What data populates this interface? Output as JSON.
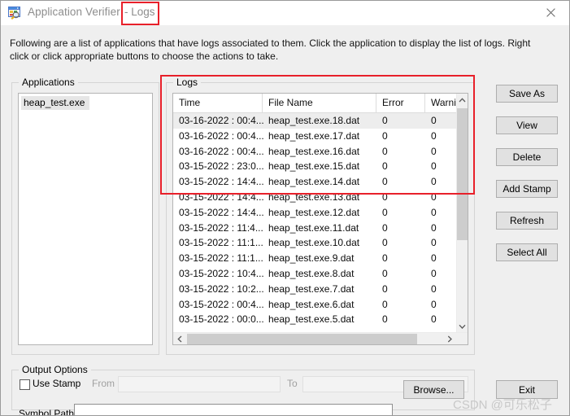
{
  "window": {
    "title": "Application Verifier",
    "subtitle": "- Logs",
    "icon": "app-verifier-icon",
    "close_label": "✕",
    "accent_annotation_color": "#e8202a"
  },
  "description": "Following are a list of applications that have logs associated to them. Click the application to display the list of logs. Right click or click appropriate buttons to choose the actions to take.",
  "applications": {
    "group_label": "Applications",
    "items": [
      {
        "label": "heap_test.exe",
        "selected": true
      }
    ]
  },
  "logs": {
    "group_label": "Logs",
    "columns": [
      "Time",
      "File Name",
      "Error",
      "Warning"
    ],
    "rows": [
      {
        "time": "03-16-2022 : 00:4...",
        "file": "heap_test.exe.18.dat",
        "error": "0",
        "warning": "0",
        "selected": true
      },
      {
        "time": "03-16-2022 : 00:4...",
        "file": "heap_test.exe.17.dat",
        "error": "0",
        "warning": "0",
        "selected": false
      },
      {
        "time": "03-16-2022 : 00:4...",
        "file": "heap_test.exe.16.dat",
        "error": "0",
        "warning": "0",
        "selected": false
      },
      {
        "time": "03-15-2022 : 23:0...",
        "file": "heap_test.exe.15.dat",
        "error": "0",
        "warning": "0",
        "selected": false
      },
      {
        "time": "03-15-2022 : 14:4...",
        "file": "heap_test.exe.14.dat",
        "error": "0",
        "warning": "0",
        "selected": false
      },
      {
        "time": "03-15-2022 : 14:4...",
        "file": "heap_test.exe.13.dat",
        "error": "0",
        "warning": "0",
        "selected": false
      },
      {
        "time": "03-15-2022 : 14:4...",
        "file": "heap_test.exe.12.dat",
        "error": "0",
        "warning": "0",
        "selected": false
      },
      {
        "time": "03-15-2022 : 11:4...",
        "file": "heap_test.exe.11.dat",
        "error": "0",
        "warning": "0",
        "selected": false
      },
      {
        "time": "03-15-2022 : 11:1...",
        "file": "heap_test.exe.10.dat",
        "error": "0",
        "warning": "0",
        "selected": false
      },
      {
        "time": "03-15-2022 : 11:1...",
        "file": "heap_test.exe.9.dat",
        "error": "0",
        "warning": "0",
        "selected": false
      },
      {
        "time": "03-15-2022 : 10:4...",
        "file": "heap_test.exe.8.dat",
        "error": "0",
        "warning": "0",
        "selected": false
      },
      {
        "time": "03-15-2022 : 10:2...",
        "file": "heap_test.exe.7.dat",
        "error": "0",
        "warning": "0",
        "selected": false
      },
      {
        "time": "03-15-2022 : 00:4...",
        "file": "heap_test.exe.6.dat",
        "error": "0",
        "warning": "0",
        "selected": false
      },
      {
        "time": "03-15-2022 : 00:0...",
        "file": "heap_test.exe.5.dat",
        "error": "0",
        "warning": "0",
        "selected": false
      }
    ]
  },
  "buttons": {
    "save_as": "Save As",
    "view": "View",
    "delete": "Delete",
    "add_stamp": "Add Stamp",
    "refresh": "Refresh",
    "select_all": "Select All",
    "browse": "Browse...",
    "exit": "Exit"
  },
  "output_options": {
    "group_label": "Output Options",
    "use_stamp_label": "Use Stamp",
    "use_stamp_checked": false,
    "from_label": "From",
    "from_value": "",
    "to_label": "To",
    "to_value": "",
    "symbol_path_label": "Symbol Path",
    "symbol_path_value": ""
  },
  "watermark": "CSDN @可乐松子"
}
